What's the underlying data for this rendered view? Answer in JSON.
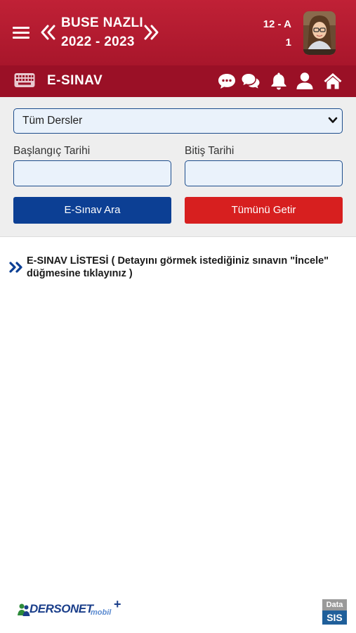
{
  "header": {
    "student_name": "BUSE NAZLI",
    "school_year": "2022 - 2023",
    "class_name": "12 - A",
    "class_no": "1",
    "icons": [
      "menu-icon",
      "chevron-double-left-icon",
      "chevron-double-right-icon",
      "avatar"
    ]
  },
  "section": {
    "title": "E-SINAV",
    "icons": [
      "keyboard-icon",
      "comment-icon",
      "comments-icon",
      "bell-icon",
      "user-icon",
      "home-icon"
    ]
  },
  "filters": {
    "course_select": {
      "value": "Tüm Dersler"
    },
    "start_date": {
      "label": "Başlangıç Tarihi",
      "value": ""
    },
    "end_date": {
      "label": "Bitiş Tarihi",
      "value": ""
    },
    "search_button": "E-Sınav Ara",
    "fetch_all_button": "Tümünü Getir"
  },
  "list": {
    "heading_bold": "E-SINAV LİSTESİ",
    "heading_note": " ( Detayını görmek istediğiniz sınavın \"İncele\" düğmesine tıklayınız )"
  },
  "footer": {
    "dersonet_logo": "DERSONET",
    "dersonet_sub": "mobil",
    "datasis_top": "Data",
    "datasis_bottom": "SIS"
  },
  "colors": {
    "header_red": "#c02136",
    "section_red": "#9a1026",
    "primary_blue": "#0c3f94",
    "danger_red": "#d71f1f",
    "panel_gray": "#eeeeee"
  }
}
